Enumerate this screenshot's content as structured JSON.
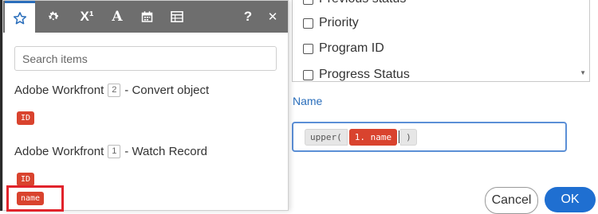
{
  "background": {
    "checklist": [
      "Previous status",
      "Priority",
      "Program ID",
      "Progress Status"
    ],
    "field_label": "Name",
    "formula": {
      "fn_open": "upper(",
      "token": "1. name",
      "fn_close": ")"
    },
    "buttons": {
      "cancel": "Cancel",
      "ok": "OK"
    }
  },
  "panel": {
    "toolbar": {
      "icons": [
        "star-icon",
        "gear-icon",
        "superscript-icon",
        "text-icon",
        "calendar-icon",
        "table-icon",
        "help-icon",
        "close-icon"
      ],
      "x1_label": "X¹",
      "a_label": "A",
      "help_label": "?",
      "close_label": "✕"
    },
    "search": {
      "placeholder": "Search items"
    },
    "modules": [
      {
        "name_prefix": "Adobe Workfront",
        "number": "2",
        "name_suffix": "- Convert object",
        "items": [
          "ID"
        ]
      },
      {
        "name_prefix": "Adobe Workfront",
        "number": "1",
        "name_suffix": "- Watch Record",
        "items": [
          "ID",
          "name"
        ]
      }
    ]
  },
  "colors": {
    "accent": "#2a6ebb",
    "token": "#d9432e",
    "ok": "#1f6fd1",
    "highlight": "#e1232b"
  }
}
